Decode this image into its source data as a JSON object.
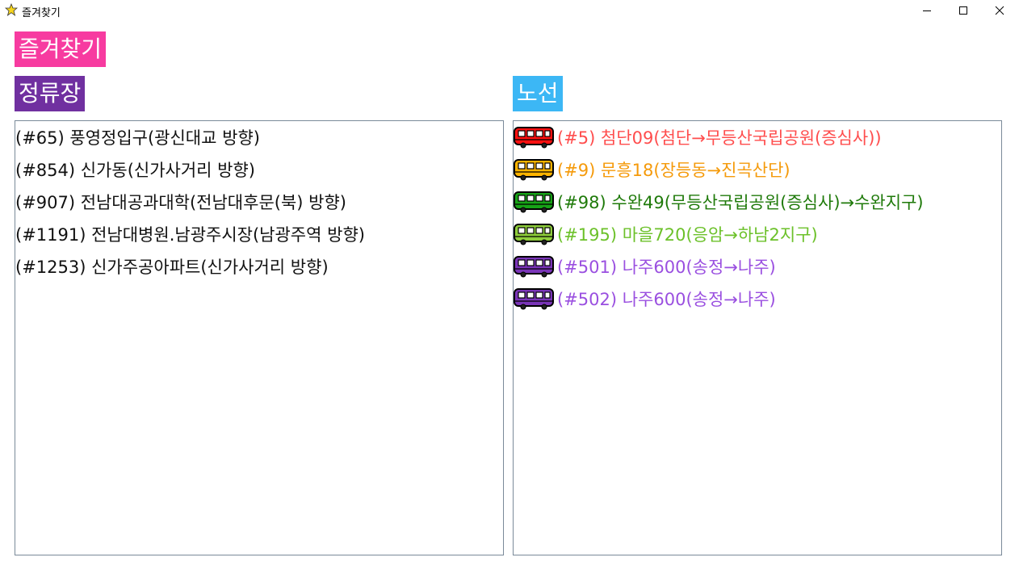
{
  "window": {
    "title": "즐겨찾기"
  },
  "header": {
    "title": "즐겨찾기",
    "color": "#f73ba0"
  },
  "stops_section": {
    "label": "정류장",
    "color": "#7030a0",
    "items": [
      "(#65) 풍영정입구(광신대교 방향)",
      "(#854) 신가동(신가사거리 방향)",
      "(#907) 전남대공과대학(전남대후문(북) 방향)",
      "(#1191) 전남대병원.남광주시장(남광주역 방향)",
      "(#1253) 신가주공아파트(신가사거리 방향)"
    ]
  },
  "routes_section": {
    "label": "노선",
    "color": "#3cb7f5",
    "items": [
      {
        "text": "(#5) 첨단09(첨단→무등산국립공원(증심사))",
        "color": "#ff4d4d",
        "bus_color": "#ff1010",
        "icon": "bus-icon"
      },
      {
        "text": "(#9) 문흥18(장등동→진곡산단)",
        "color": "#f59a0a",
        "bus_color": "#ffb400",
        "icon": "bus-icon"
      },
      {
        "text": "(#98) 수완49(무등산국립공원(증심사)→수완지구)",
        "color": "#1f7a0a",
        "bus_color": "#17a317",
        "icon": "bus-icon"
      },
      {
        "text": "(#195) 마을720(응암→하남2지구)",
        "color": "#6cc12a",
        "bus_color": "#8fce3c",
        "icon": "bus-icon"
      },
      {
        "text": "(#501) 나주600(송정→나주)",
        "color": "#9a4fe0",
        "bus_color": "#7a35b8",
        "icon": "bus-icon"
      },
      {
        "text": "(#502) 나주600(송정→나주)",
        "color": "#9a4fe0",
        "bus_color": "#7a35b8",
        "icon": "bus-icon"
      }
    ]
  }
}
